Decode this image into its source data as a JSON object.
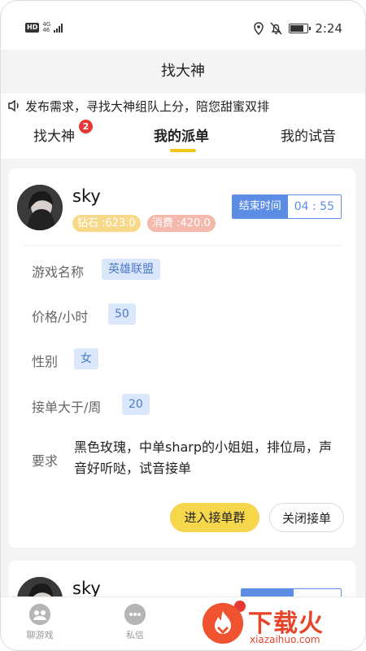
{
  "status_bar": {
    "hd": "HD",
    "network_top": "4G",
    "network_bottom": "46",
    "time": "2:24",
    "battery_level": 0.85
  },
  "header": {
    "title": "找大神"
  },
  "notice": {
    "text": "发布需求，寻找大神组队上分，陪您甜蜜双排"
  },
  "tabs": [
    {
      "label": "找大神",
      "badge": "2"
    },
    {
      "label": "我的派单",
      "active": true
    },
    {
      "label": "我的试音"
    }
  ],
  "order": {
    "username": "sky",
    "diamond": "钻石 :623.0",
    "consume": "消费 :420.0",
    "end_time_label": "结束时间",
    "end_time_value": "04 : 55",
    "fields": [
      {
        "label": "游戏名称",
        "value": "英雄联盟"
      },
      {
        "label": "价格/小时",
        "value": "50"
      },
      {
        "label": "性别",
        "value": "女"
      },
      {
        "label": "接单大于/周",
        "value": "20"
      }
    ],
    "requirement_label": "要求",
    "requirement_text": "黑色玫瑰，中单sharp的小姐姐，排位局，声音好听哒，试音接单",
    "join_button": "进入接单群",
    "close_button": "关闭接单"
  },
  "order2": {
    "username": "sky"
  },
  "bottom_nav": [
    {
      "label": "聊游戏",
      "icon": "chat-game-icon"
    },
    {
      "label": "私信",
      "icon": "message-icon"
    }
  ],
  "watermark": {
    "text": "下载火",
    "sub": "xiazaihuo.com"
  },
  "colors": {
    "accent_yellow": "#f6d64a",
    "tag_blue": "#5b8de5",
    "badge_red": "#e53935"
  }
}
